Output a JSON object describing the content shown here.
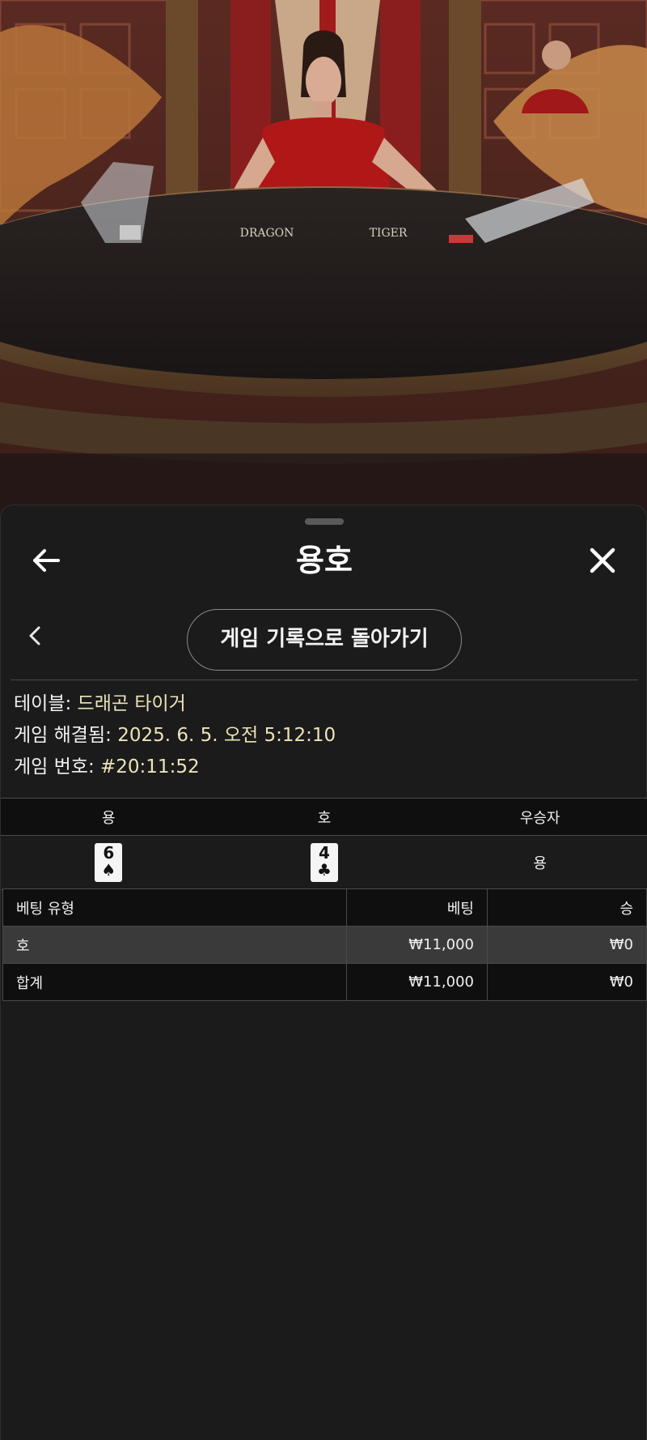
{
  "header": {
    "title": "용호"
  },
  "history_button_label": "게임 기록으로 돌아가기",
  "info": {
    "table_label": "테이블:",
    "table_value": "드래곤 타이거",
    "resolved_label": "게임 해결됨:",
    "resolved_value": "2025. 6. 5. 오전 5:12:10",
    "game_number_label": "게임 번호:",
    "game_number_value": "#20:11:52"
  },
  "result_table": {
    "headers": [
      "용",
      "호",
      "우승자"
    ],
    "dragon_card": {
      "rank": "6",
      "suit": "♠"
    },
    "tiger_card": {
      "rank": "4",
      "suit": "♣"
    },
    "winner": "용"
  },
  "bet_table": {
    "headers": [
      "베팅 유형",
      "베팅",
      "승"
    ],
    "rows": [
      {
        "type": "호",
        "bet": "₩11,000",
        "win": "₩0"
      },
      {
        "type": "합계",
        "bet": "₩11,000",
        "win": "₩0"
      }
    ]
  },
  "video": {
    "table_label_left": "DRAGON",
    "table_label_right": "TIGER"
  },
  "colors": {
    "sheet_background": "#1b1b1b",
    "value_text": "#ece3b8",
    "header_background": "#0f0f0f",
    "highlight_row": "#3a3a3a"
  }
}
